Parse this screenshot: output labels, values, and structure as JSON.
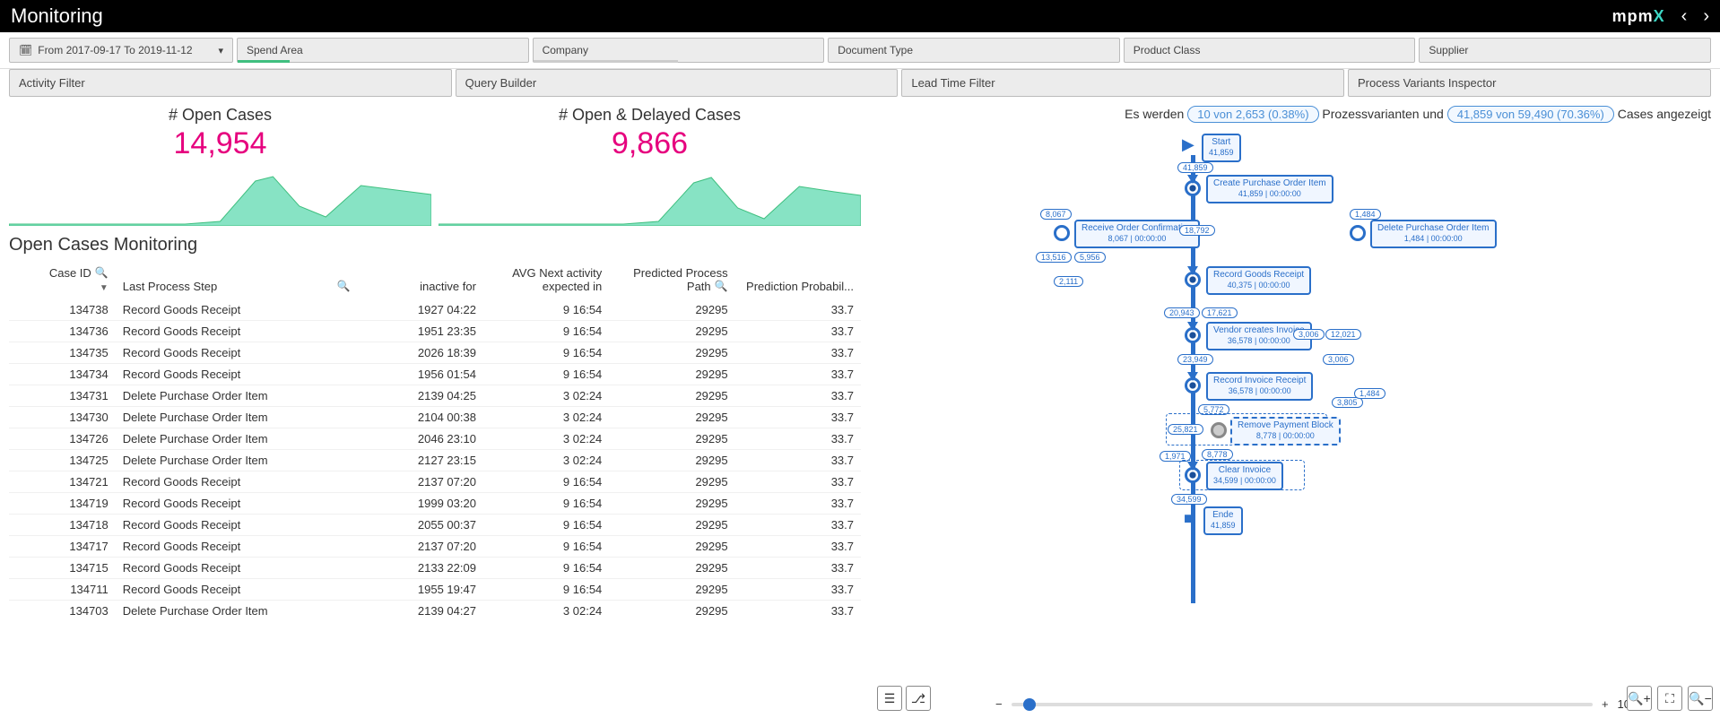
{
  "header": {
    "title": "Monitoring",
    "logo_prefix": "mpm",
    "logo_suffix": "X"
  },
  "filters": {
    "date_label": "From 2017-09-17 To 2019-11-12",
    "spend_area": "Spend Area",
    "company": "Company",
    "document_type": "Document Type",
    "product_class": "Product Class",
    "supplier": "Supplier"
  },
  "secondary": {
    "activity_filter": "Activity Filter",
    "query_builder": "Query Builder",
    "lead_time_filter": "Lead Time Filter",
    "process_variants": "Process Variants Inspector"
  },
  "kpis": {
    "open_title": "# Open Cases",
    "open_value": "14,954",
    "delayed_title": "# Open & Delayed Cases",
    "delayed_value": "9,866"
  },
  "table_title": "Open Cases Monitoring",
  "columns": {
    "case_id": "Case ID",
    "last_step": "Last Process Step",
    "inactive": "inactive for",
    "avg_next": "AVG Next activity expected in",
    "predicted_path": "Predicted Process Path",
    "prediction_prob": "Prediction Probabil..."
  },
  "rows": [
    {
      "id": "134738",
      "step": "Record Goods Receipt",
      "inactive": "1927 04:22",
      "avg": "9 16:54",
      "path": "29295",
      "prob": "33.7"
    },
    {
      "id": "134736",
      "step": "Record Goods Receipt",
      "inactive": "1951 23:35",
      "avg": "9 16:54",
      "path": "29295",
      "prob": "33.7"
    },
    {
      "id": "134735",
      "step": "Record Goods Receipt",
      "inactive": "2026 18:39",
      "avg": "9 16:54",
      "path": "29295",
      "prob": "33.7"
    },
    {
      "id": "134734",
      "step": "Record Goods Receipt",
      "inactive": "1956 01:54",
      "avg": "9 16:54",
      "path": "29295",
      "prob": "33.7"
    },
    {
      "id": "134731",
      "step": "Delete Purchase Order Item",
      "inactive": "2139 04:25",
      "avg": "3 02:24",
      "path": "29295",
      "prob": "33.7"
    },
    {
      "id": "134730",
      "step": "Delete Purchase Order Item",
      "inactive": "2104 00:38",
      "avg": "3 02:24",
      "path": "29295",
      "prob": "33.7"
    },
    {
      "id": "134726",
      "step": "Delete Purchase Order Item",
      "inactive": "2046 23:10",
      "avg": "3 02:24",
      "path": "29295",
      "prob": "33.7"
    },
    {
      "id": "134725",
      "step": "Delete Purchase Order Item",
      "inactive": "2127 23:15",
      "avg": "3 02:24",
      "path": "29295",
      "prob": "33.7"
    },
    {
      "id": "134721",
      "step": "Record Goods Receipt",
      "inactive": "2137 07:20",
      "avg": "9 16:54",
      "path": "29295",
      "prob": "33.7"
    },
    {
      "id": "134719",
      "step": "Record Goods Receipt",
      "inactive": "1999 03:20",
      "avg": "9 16:54",
      "path": "29295",
      "prob": "33.7"
    },
    {
      "id": "134718",
      "step": "Record Goods Receipt",
      "inactive": "2055 00:37",
      "avg": "9 16:54",
      "path": "29295",
      "prob": "33.7"
    },
    {
      "id": "134717",
      "step": "Record Goods Receipt",
      "inactive": "2137 07:20",
      "avg": "9 16:54",
      "path": "29295",
      "prob": "33.7"
    },
    {
      "id": "134715",
      "step": "Record Goods Receipt",
      "inactive": "2133 22:09",
      "avg": "9 16:54",
      "path": "29295",
      "prob": "33.7"
    },
    {
      "id": "134711",
      "step": "Record Goods Receipt",
      "inactive": "1955 19:47",
      "avg": "9 16:54",
      "path": "29295",
      "prob": "33.7"
    },
    {
      "id": "134703",
      "step": "Delete Purchase Order Item",
      "inactive": "2139 04:27",
      "avg": "3 02:24",
      "path": "29295",
      "prob": "33.7"
    }
  ],
  "summary": {
    "prefix": "Es werden",
    "variants_pill": "10 von 2,653 (0.38%)",
    "mid": "Prozessvarianten und",
    "cases_pill": "41,859 von 59,490 (70.36%)",
    "suffix": "Cases angezeigt"
  },
  "process": {
    "start": "Start",
    "start_count": "41,859",
    "end": "Ende",
    "end_count": "41,859",
    "nodes": {
      "create_po": {
        "label": "Create Purchase Order Item",
        "count": "41,859",
        "time": "00:00:00"
      },
      "receive_conf": {
        "label": "Receive Order Confirmation",
        "count": "8,067",
        "time": "00:00:00"
      },
      "delete_po": {
        "label": "Delete Purchase Order Item",
        "count": "1,484",
        "time": "00:00:00"
      },
      "record_goods": {
        "label": "Record Goods Receipt",
        "count": "40,375",
        "time": "00:00:00"
      },
      "vendor_inv": {
        "label": "Vendor creates Invoice",
        "count": "36,578",
        "time": "00:00:00"
      },
      "record_inv": {
        "label": "Record Invoice Receipt",
        "count": "36,578",
        "time": "00:00:00"
      },
      "remove_block": {
        "label": "Remove Payment Block",
        "count": "8,778",
        "time": "00:00:00"
      },
      "clear_inv": {
        "label": "Clear Invoice",
        "count": "34,599",
        "time": "00:00:00"
      }
    },
    "edges": {
      "e1": "41,859",
      "e2": "8,067",
      "e3": "18,792",
      "e4": "1,484",
      "e5": "13,516",
      "e6": "5,956",
      "e7": "2,111",
      "e8": "20,943",
      "e9": "17,621",
      "e10": "23,949",
      "e11": "3,006",
      "e12": "12,021",
      "e13": "5,772",
      "e14": "3,006",
      "e15": "25,821",
      "e16": "8,778",
      "e17": "1,971",
      "e18": "34,599",
      "e19": "3,805",
      "e20": "1,484"
    }
  },
  "zoom_value": "10",
  "chart_data": [
    {
      "type": "area",
      "title": "# Open Cases",
      "x": [
        0,
        1,
        2,
        3,
        4,
        5,
        6,
        7,
        8,
        9,
        10,
        11
      ],
      "values": [
        0,
        0,
        0,
        0,
        0,
        5,
        55,
        60,
        30,
        15,
        50,
        45
      ],
      "ylim": [
        0,
        70
      ],
      "color": "#87e3c4"
    },
    {
      "type": "area",
      "title": "# Open & Delayed Cases",
      "x": [
        0,
        1,
        2,
        3,
        4,
        5,
        6,
        7,
        8,
        9,
        10,
        11
      ],
      "values": [
        0,
        0,
        0,
        0,
        0,
        3,
        50,
        58,
        28,
        12,
        48,
        42
      ],
      "ylim": [
        0,
        70
      ],
      "color": "#87e3c4"
    }
  ]
}
